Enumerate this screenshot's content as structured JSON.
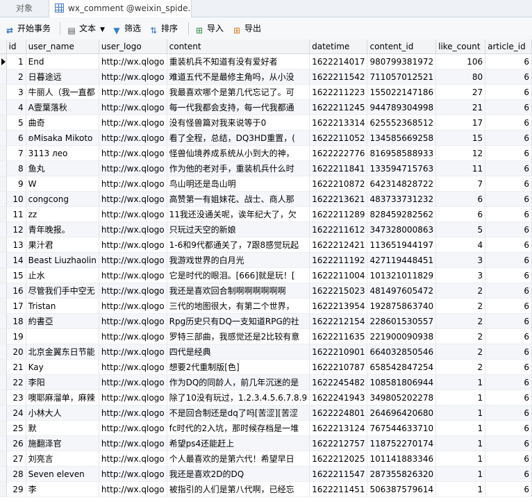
{
  "tabs": [
    {
      "label": "对象"
    },
    {
      "label": "wx_comment @weixin_spide..."
    }
  ],
  "toolbar": {
    "begin_tx": "开始事务",
    "text": "文本",
    "filter": "筛选",
    "sort": "排序",
    "import": "导入",
    "export": "导出"
  },
  "columns": [
    "id",
    "user_name",
    "user_logo",
    "content",
    "datetime",
    "content_id",
    "like_count",
    "article_id"
  ],
  "rows": [
    [
      "1",
      "End",
      "http://wx.qlogo",
      "重装机兵不知道有没有爱好者",
      "1622214017",
      "980799381972",
      "106",
      "6"
    ],
    [
      "2",
      "日暮途远",
      "http://wx.qlogo",
      "难道五代不是最修主角吗，从小没",
      "1622211542",
      "711057012521",
      "80",
      "6"
    ],
    [
      "3",
      "牛丽人（我一直都",
      "http://wx.qlogo",
      "我最喜欢哪个是第几代忘记了。可",
      "1622211223",
      "155022147186",
      "27",
      "6"
    ],
    [
      "4",
      "A壹葉落秋",
      "http://wx.qlogo",
      "每一代我都会支持，每一代我都通",
      "1622211245",
      "944789304998",
      "21",
      "6"
    ],
    [
      "5",
      "曲奇",
      "http://wx.qlogo",
      "没有怪兽篇对我来说等于0",
      "1622213314",
      "625552368512",
      "17",
      "6"
    ],
    [
      "6",
      "ʚMisaka Mikoto",
      "http://wx.qlogo",
      "看了全程，总结，DQ3HD重置，(",
      "1622211052",
      "134585669258",
      "15",
      "6"
    ],
    [
      "7",
      "3113  леo",
      "http://wx.qlogo",
      "怪兽仙境养成系统从小到大的神，",
      "1622222776",
      "816958588933",
      "12",
      "6"
    ],
    [
      "8",
      "鱼丸",
      "http://wx.qlogo",
      "作为他的老对手，重装机兵什么时",
      "1622211841",
      "133594715763",
      "11",
      "6"
    ],
    [
      "9",
      "W",
      "http://wx.qlogo",
      "鸟山明还是岛山明",
      "1622210872",
      "642314828722",
      "7",
      "6"
    ],
    [
      "10",
      "congcong",
      "http://wx.qlogo",
      "高赞第一有姐妹花、战士、商人那",
      "1622213621",
      "483733731232",
      "6",
      "6"
    ],
    [
      "11",
      "zz",
      "http://wx.qlogo",
      "11我还没通关呢，诶年纪大了，欠",
      "1622211289",
      "828459282562",
      "6",
      "6"
    ],
    [
      "12",
      "青年晚报。",
      "http://wx.qlogo",
      "只玩过天空的新娘",
      "1622211612",
      "347328000863",
      "5",
      "6"
    ],
    [
      "13",
      "果汁君",
      "http://wx.qlogo",
      "1-6和9代都通关了，7跟8感觉玩起",
      "1622212421",
      "113651944197",
      "4",
      "6"
    ],
    [
      "14",
      "Beast Liuzhaolin",
      "http://wx.qlogo",
      "我游戏世界的白月光",
      "1622211192",
      "427119448451",
      "3",
      "6"
    ],
    [
      "15",
      "止水",
      "http://wx.qlogo",
      "它是时代的眼泪。[666]就是玩！[",
      "1622211004",
      "101321011829",
      "3",
      "6"
    ],
    [
      "16",
      "尽管我们手中空无",
      "http://wx.qlogo",
      "我还是喜欢回合制啊啊啊啊啊啊",
      "1622215023",
      "481497605472",
      "2",
      "6"
    ],
    [
      "17",
      "Tristan",
      "http://wx.qlogo",
      "三代的地图很大，有第二个世界，",
      "1622213954",
      "192875863740",
      "2",
      "6"
    ],
    [
      "18",
      "約書亞",
      "http://wx.qlogo",
      "Rpg历史只有DQ一支知道RPG的社",
      "1622212154",
      "228601530557",
      "2",
      "6"
    ],
    [
      "19",
      "",
      "http://wx.qlogo",
      "罗特三部曲，我感觉还是2比较有意",
      "1622211635",
      "221900090938",
      "2",
      "6"
    ],
    [
      "20",
      "北京金翼东日节能",
      "http://wx.qlogo",
      "四代是经典",
      "1622210901",
      "664032850546",
      "2",
      "6"
    ],
    [
      "21",
      "Kay",
      "http://wx.qlogo",
      "想要2代重制版[色]",
      "1622210787",
      "658542847254",
      "2",
      "6"
    ],
    [
      "22",
      "李阳",
      "http://wx.qlogo",
      "作为DQ的同龄人，前几年沉迷的是",
      "1622245482",
      "108581806944",
      "1",
      "6"
    ],
    [
      "23",
      "噢耶麻溜单，麻辣",
      "http://wx.qlogo",
      "除了10没有玩过，1.2.3.4.5.6.7.8.9",
      "1622241943",
      "349805202278",
      "1",
      "6"
    ],
    [
      "24",
      "小林大人",
      "http://wx.qlogo",
      "不是回合制还是dq了吗[苦涩][苦涩",
      "1622224801",
      "264696420680",
      "1",
      "6"
    ],
    [
      "25",
      "默",
      "http://wx.qlogo",
      "fc时代的2入坑，那时候存档是一堆",
      "1622213124",
      "767544633710",
      "1",
      "6"
    ],
    [
      "26",
      "施翻泽官",
      "http://wx.qlogo",
      "希望ps4还能赶上",
      "1622212757",
      "118752270174",
      "1",
      "6"
    ],
    [
      "27",
      "刘亮言",
      "http://wx.qlogo",
      "个人最喜欢的是第六代！希望早日",
      "1622212025",
      "101141883346",
      "1",
      "6"
    ],
    [
      "28",
      "Seven eleven",
      "http://wx.qlogo",
      "我还是喜欢2D的DQ",
      "1622211547",
      "287355826320",
      "1",
      "6"
    ],
    [
      "29",
      "李",
      "http://wx.qlogo",
      "被指引的人们是第八代啊，已经忘",
      "1622211451",
      "506387579614",
      "1",
      "6"
    ]
  ]
}
